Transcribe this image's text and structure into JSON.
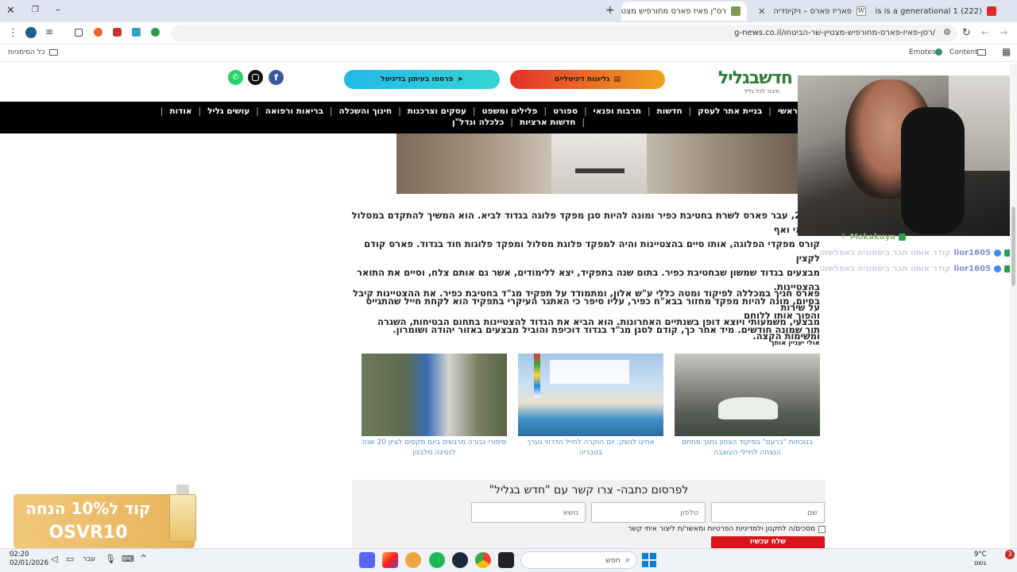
{
  "browser": {
    "tabs": [
      {
        "label": "This is a generational 1 (222)",
        "color": "#e02b2b"
      },
      {
        "label": "פאריז פארס – ויקיפדיה",
        "color": "#888888"
      },
      {
        "label": "רס\"ן פאיז פארס מחורפיש מצטיי",
        "color": "#7a9a5a"
      }
    ],
    "url": "g-news.co.il/רסן-פאיז-פארס-מחורפיש-מצטיין-שר-הביטחו/",
    "bookmarks_label": "כל הסימניות",
    "emotes_label": "Emotes",
    "content_label": "Content"
  },
  "site": {
    "logo_text": "חדשבגליל",
    "logo_sub": "חיבור לכל גליל",
    "btn_ads": "גליונות דיגיטליים",
    "btn_publish": "פרסמו בעיתון בדיגיטל",
    "nav_row1": [
      "ראשי",
      "בניית אתר לעסק",
      "חדשות",
      "תרבות ופנאי",
      "ספורט",
      "פלילים ומשפט",
      "עסקים וצרכנות",
      "חינוך והשכלה",
      "בריאות ורפואה",
      "עושים גליל",
      "אודות"
    ],
    "nav_row2": [
      "חדשות ארציות",
      "כלכלה ונדל\"ן"
    ]
  },
  "article": {
    "para1_lines": [
      "2020, עבר פארס לשרת בחטיבת כפיר ומונה להיות סגן מפקד פלוגה בגדוד לביא. הוא המשיך להתקדם במסלול הצבאי ואף",
      "קורס מפקדי הפלוגה, אותו סיים בהצטיינות והיה למפקד פלוגת מסלול ומפקד פלוגות חוד בגדוד. פארס קודם לקצין",
      "מבצעים בגדוד שמשון שבחטיבת כפיר. בתום שנה בתפקיד, יצא ללימודים, אשר גם אותם צלח, וסיים את התואר בהצטיינות.",
      "בסיום, מונה להיות מפקד מחזור בבא\"ח כפיר, עליו סיפר כי האתגר העיקרי בתפקיד הוא לקחת חייל שהתגייס והפוך אותו ללוחם",
      "תוך שמונה חודשים. מיד אחר כך, קודם לסגן מג\"ד בגדוד דוכיפת והוביל מבצעים באזור יהודה ושומרון."
    ],
    "para2_lines": [
      "פארס חניך במכללה לפיקוד ומטה כללי ע\"ש אלון, ומתמודד על תפקיד מג\"ד בחטיבת כפיר. את ההצטיינות קיבל על שירות",
      "מבצעי, משמעותי ויוצא דופן בשנתיים האחרונות. הוא הביא את הגדוד להצטיינות בתחום הבטיחות, השגרה ומשימות הקצה."
    ],
    "related_title": "אולי יעניין אותך",
    "cards": [
      {
        "caption": "בנוכחות \"ברעם\" בפיקוד הצפון נחנך מתחם הנצחה לחיילי העוצבה"
      },
      {
        "caption": "אחינו לנשק: יום הוקרה לחייל הדרוזי נערך בטבריה"
      },
      {
        "caption": "סיפורי גבורה מרגשים ביום מקסים לציון 20 שנה לנסיגה מלבנון"
      }
    ],
    "contact_title": "לפרסום כתבה- צרו קשר עם \"חדש בגליל\"",
    "field_name": "שם",
    "field_phone": "טלפון",
    "field_subject": "נושא",
    "consent_text": "מסכים/ה לתקנון ולמדיניות הפרטיות ומאשר/ת ליצור איתי קשר",
    "submit_label": "שלח עכשיו"
  },
  "promo": {
    "line1": "קוד ל10% הנחה",
    "line2": "OSVR10"
  },
  "chat": {
    "lines": [
      {
        "user": "Mokakuya",
        "text": ""
      },
      {
        "user": "lior1605",
        "text": "קודר אותה חבר ביטחונית באפלשזה"
      },
      {
        "user": "lior1605",
        "text": "קודר אותה חבר ביטחונית באפלשזה"
      }
    ]
  },
  "taskbar": {
    "time": "02:20",
    "date": "02/01/2026",
    "lang": "עבר",
    "search_placeholder": "חפש",
    "weather_temp": "9°C",
    "weather_text": "גשם",
    "badge": "3"
  }
}
